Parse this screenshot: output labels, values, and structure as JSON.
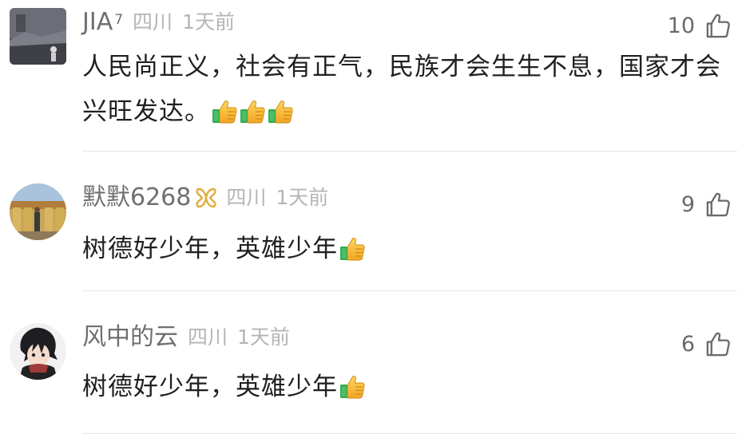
{
  "comments": [
    {
      "username": "JIA",
      "superscript": "7",
      "location": "四川",
      "time": "1天前",
      "likes": "10",
      "text": "人民尚正义，社会有正气，民族才会生生不息，国家才会兴旺发达。",
      "emoji_count": 3
    },
    {
      "username": "默默6268",
      "location": "四川",
      "time": "1天前",
      "likes": "9",
      "text": "树德好少年，英雄少年",
      "emoji_count": 1
    },
    {
      "username": "风中的云",
      "location": "四川",
      "time": "1天前",
      "likes": "6",
      "text": "树德好少年，英雄少年",
      "emoji_count": 1
    }
  ],
  "icons": {
    "like": "thumbs-up-outline-icon",
    "emoji": "thumbs-up-emoji",
    "badge": "gold-ribbon-badge-icon"
  },
  "colors": {
    "username": "#6f6f6f",
    "meta": "#b5b5b5",
    "text": "#202020",
    "divider": "#e6e6e6",
    "badge": "#e2ad41"
  }
}
